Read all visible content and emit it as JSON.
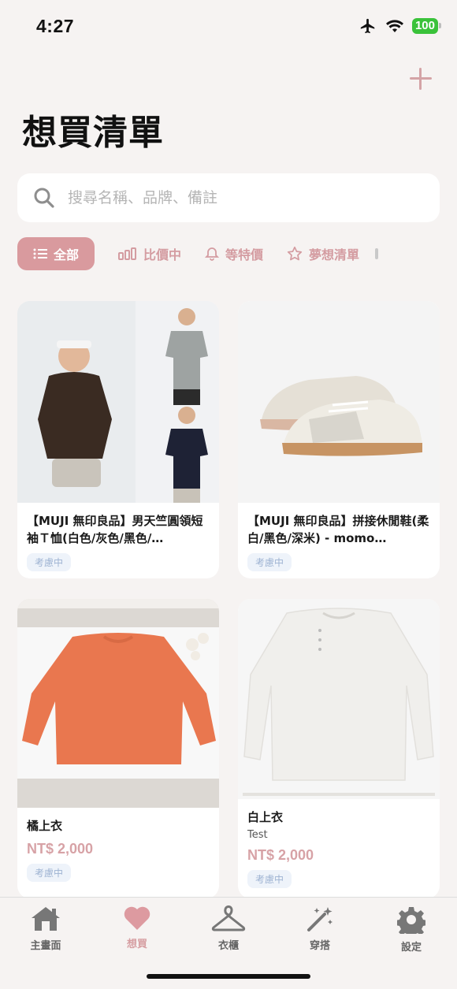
{
  "status_bar": {
    "time": "4:27",
    "battery": "100"
  },
  "header": {
    "title": "想買清單"
  },
  "search": {
    "placeholder": "搜尋名稱、品牌、備註"
  },
  "filters": [
    {
      "label": "全部",
      "icon": "list-icon",
      "active": true
    },
    {
      "label": "比價中",
      "icon": "bars-icon"
    },
    {
      "label": "等特價",
      "icon": "bell-icon"
    },
    {
      "label": "夢想清單",
      "icon": "star-icon"
    }
  ],
  "items": [
    {
      "title": "【MUJI 無印良品】男天竺圓領短袖Ｔ恤(白色/灰色/黑色/…",
      "tag": "考慮中",
      "image": "muji-tshirt-photo"
    },
    {
      "title": "【MUJI 無印良品】拼接休閒鞋(柔白/黑色/深米) - momo…",
      "tag": "考慮中",
      "image": "muji-sneakers-photo"
    },
    {
      "title": "橘上衣",
      "price": "NT$ 2,000",
      "tag": "考慮中",
      "image": "orange-sweater-photo"
    },
    {
      "title": "白上衣",
      "subtitle": "Test",
      "price": "NT$ 2,000",
      "tag": "考慮中",
      "image": "white-longsleeve-photo"
    }
  ],
  "tabs": [
    {
      "label": "主畫面",
      "icon": "home-icon"
    },
    {
      "label": "想買",
      "icon": "heart-icon",
      "active": true
    },
    {
      "label": "衣櫃",
      "icon": "hanger-icon"
    },
    {
      "label": "穿搭",
      "icon": "magic-wand-icon"
    },
    {
      "label": "設定",
      "icon": "gear-icon"
    }
  ],
  "colors": {
    "accent": "#d99a9e",
    "tag_bg": "#eef3fa",
    "tag_text": "#9eb3d2",
    "background": "#f6f3f2"
  }
}
